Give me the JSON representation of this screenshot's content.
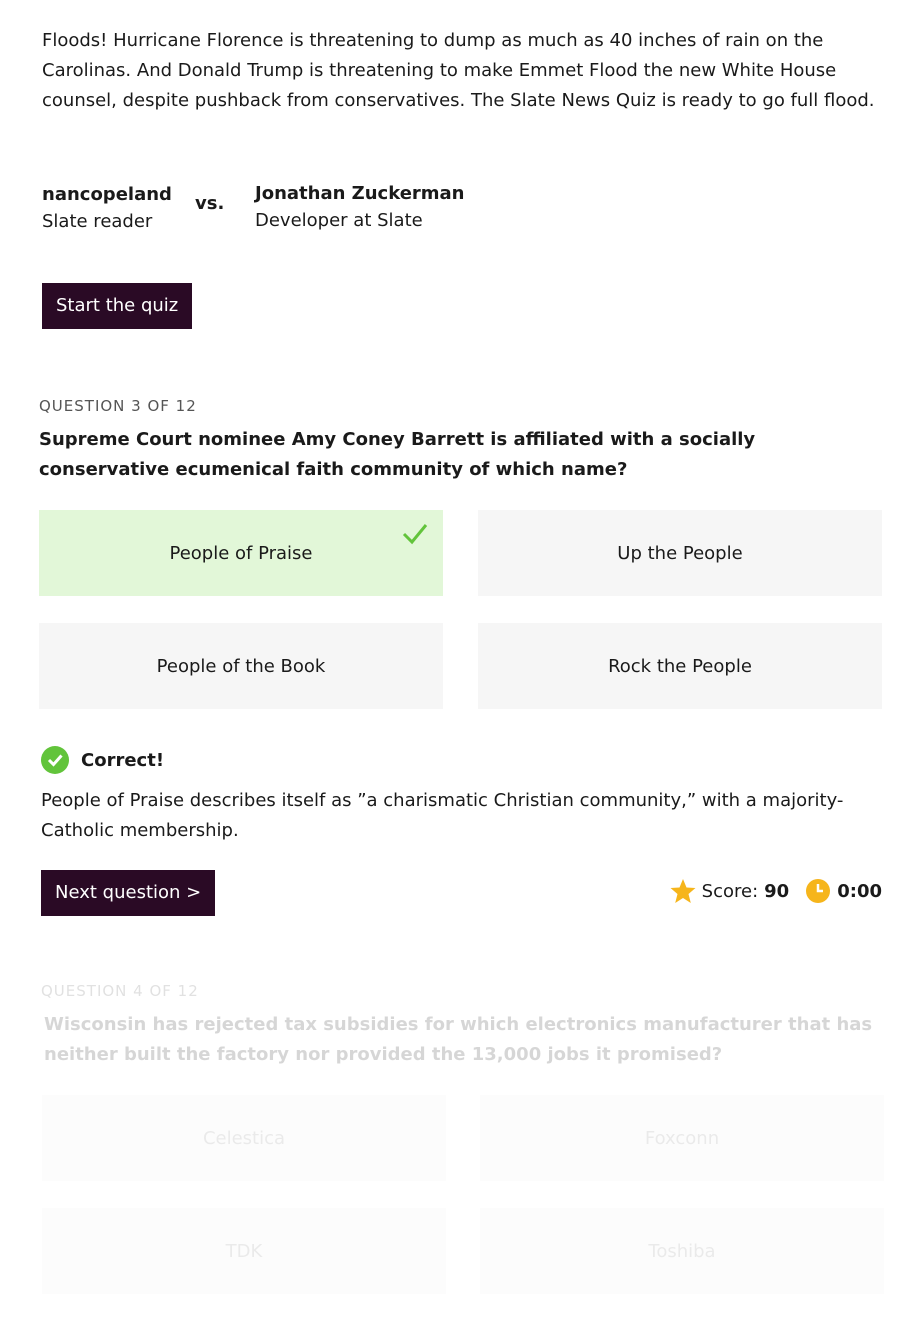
{
  "intro": "Floods! Hurricane Florence is threatening to dump as much as 40 inches of rain on the Carolinas. And Donald Trump is threatening to make Emmet Flood the new White House counsel, despite pushback from conservatives. The Slate News Quiz is ready to go full flood.",
  "players": [
    {
      "name": "nancopeland",
      "role": "Slate reader"
    },
    {
      "name": "Jonathan Zuckerman",
      "role": "Developer at Slate"
    }
  ],
  "vs_label": "vs.",
  "start_button": "Start the quiz",
  "current": {
    "counter": "QUESTION 3 OF 12",
    "question": "Supreme Court nominee Amy Coney Barrett is affiliated with a socially conservative ecumenical faith community of which name?",
    "options": [
      "People of Praise",
      "Up the People",
      "People of the Book",
      "Rock the People"
    ],
    "result_title": "Correct!",
    "explanation": "People of Praise describes itself as ”a charismatic Christian community,” with a majority-Catholic membership."
  },
  "next_button": "Next question >",
  "score": {
    "label": "Score:",
    "value": "90",
    "time": "0:00"
  },
  "upcoming": {
    "counter": "QUESTION 4 OF 12",
    "question": "Wisconsin has rejected tax subsidies for which electronics manufacturer that has neither built the factory nor provided the 13,000 jobs it promised?",
    "options": [
      "Celestica",
      "Foxconn",
      "TDK",
      "Toshiba"
    ]
  },
  "colors": {
    "dark_button": "#2a0a25",
    "correct_bg": "#e2f7d8",
    "check_green": "#62c43b",
    "accent_gold": "#f6b51b"
  },
  "icons": {
    "check": "checkmark-icon",
    "result": "check-circle-icon",
    "score": "star-icon",
    "timer": "clock-icon"
  }
}
